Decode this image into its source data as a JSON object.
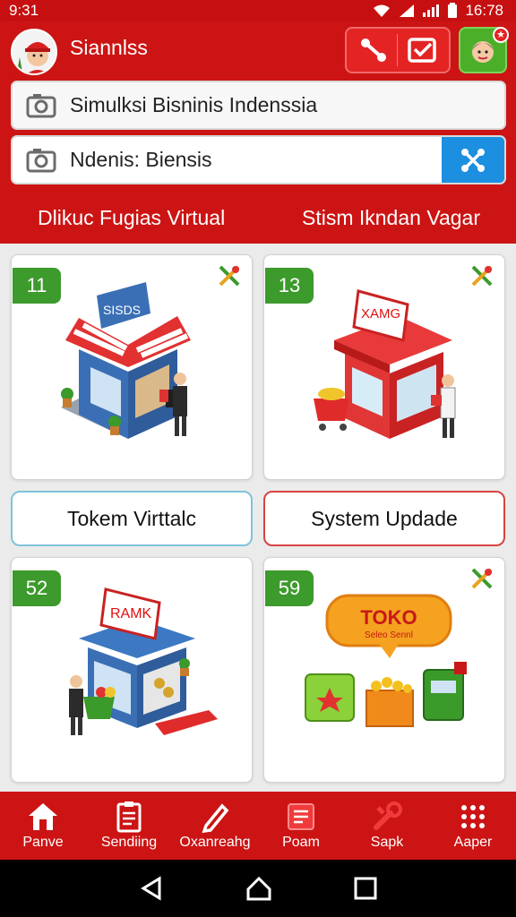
{
  "status_bar": {
    "time_left": "9:31",
    "time_right": "16:78"
  },
  "header": {
    "app_title": "Siannlss",
    "search_primary": {
      "value": "Simulksi Bisninis Indenssia"
    },
    "search_secondary": {
      "value": "Ndenis: Biensis"
    },
    "tabs": [
      {
        "label": "Dlikuc Fugias Virtual"
      },
      {
        "label": "Stism Ikndan Vagar"
      }
    ]
  },
  "cards": [
    {
      "number": "11",
      "sign": "SISDS"
    },
    {
      "number": "13",
      "sign": "XAMG"
    },
    {
      "number": "52",
      "sign": "RAMK"
    },
    {
      "number": "59",
      "bubble_title": "TOKO",
      "bubble_sub": "Seleo Sennl"
    }
  ],
  "buttons": {
    "left": "Tokem Virttalc",
    "right": "System Updade"
  },
  "bottom_nav": [
    {
      "label": "Panve",
      "icon": "home-icon"
    },
    {
      "label": "Sendiing",
      "icon": "document-icon"
    },
    {
      "label": "Oxanreahg",
      "icon": "pencil-icon"
    },
    {
      "label": "Poam",
      "icon": "folder-icon"
    },
    {
      "label": "Sapk",
      "icon": "wrench-icon"
    },
    {
      "label": "Aaper",
      "icon": "apps-grid-icon"
    }
  ],
  "colors": {
    "primary_red": "#cc1414",
    "badge_green": "#3d9a2c",
    "scan_blue": "#1d8fe0"
  }
}
